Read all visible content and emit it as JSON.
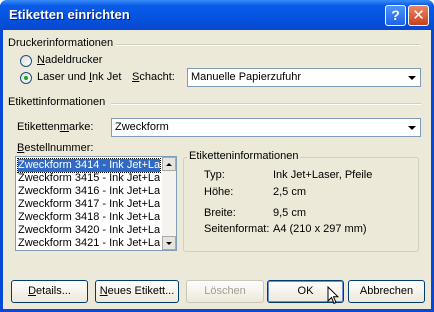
{
  "window": {
    "title": "Etiketten einrichten",
    "help_glyph": "?",
    "close_glyph": "✕"
  },
  "drucker": {
    "group_label": "Druckerinformationen",
    "option_nadel": "Nadeldrucker",
    "option_laser": "Laser und Ink Jet",
    "selected_option": "Laser und Ink Jet",
    "schacht_label": "Schacht:",
    "schacht_value": "Manuelle Papierzufuhr"
  },
  "etikett": {
    "group_label": "Etikettinformationen",
    "marke_label": "Etikettenmarke:",
    "marke_value": "Zweckform",
    "bestellnummer_label": "Bestellnummer:",
    "items": [
      "Zweckform 3414 - Ink Jet+La",
      "Zweckform 3415 - Ink Jet+La",
      "Zweckform 3416 - Ink Jet+La",
      "Zweckform 3417 - Ink Jet+La",
      "Zweckform 3418 - Ink Jet+La",
      "Zweckform 3420 - Ink Jet+La",
      "Zweckform 3421 - Ink Jet+La"
    ],
    "selected_index": 0
  },
  "details": {
    "legend": "Etiketteninformationen",
    "typ_label": "Typ:",
    "typ_value": "Ink Jet+Laser, Pfeile",
    "hoehe_label": "Höhe:",
    "hoehe_value": "2,5 cm",
    "breite_label": "Breite:",
    "breite_value": "9,5 cm",
    "format_label": "Seitenformat:",
    "format_value": "A4 (210 x 297 mm)"
  },
  "buttons": {
    "details": "Details...",
    "neues": "Neues Etikett...",
    "loeschen": "Löschen",
    "ok": "OK",
    "abbrechen": "Abbrechen"
  },
  "colors": {
    "title_bar": "#0454e0",
    "selection": "#316ac5",
    "dialog_bg": "#ece9d8",
    "radio_dot": "#21a121"
  }
}
